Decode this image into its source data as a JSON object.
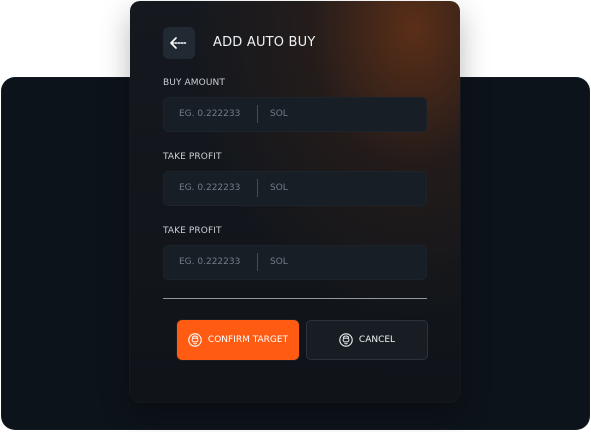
{
  "dialog": {
    "title": "ADD AUTO BUY",
    "back_icon": "back-arrow-icon"
  },
  "form": {
    "fields": [
      {
        "label": "BUY AMOUNT",
        "placeholder": "EG. 0.222233",
        "value": "",
        "unit": "SOL"
      },
      {
        "label": "TAKE PROFIT",
        "placeholder": "EG. 0.222233",
        "value": "",
        "unit": "SOL"
      },
      {
        "label": "TAKE PROFIT",
        "placeholder": "EG. 0.222233",
        "value": "",
        "unit": "SOL"
      }
    ]
  },
  "actions": {
    "confirm": {
      "label": "CONFIRM TARGET",
      "icon": "avatar-icon"
    },
    "cancel": {
      "label": "CANCEL",
      "icon": "avatar-icon"
    }
  },
  "colors": {
    "background_panel": "#0d131a",
    "modal": "#12171d",
    "accent": "#ff5b12",
    "input_background": "#171e25"
  }
}
